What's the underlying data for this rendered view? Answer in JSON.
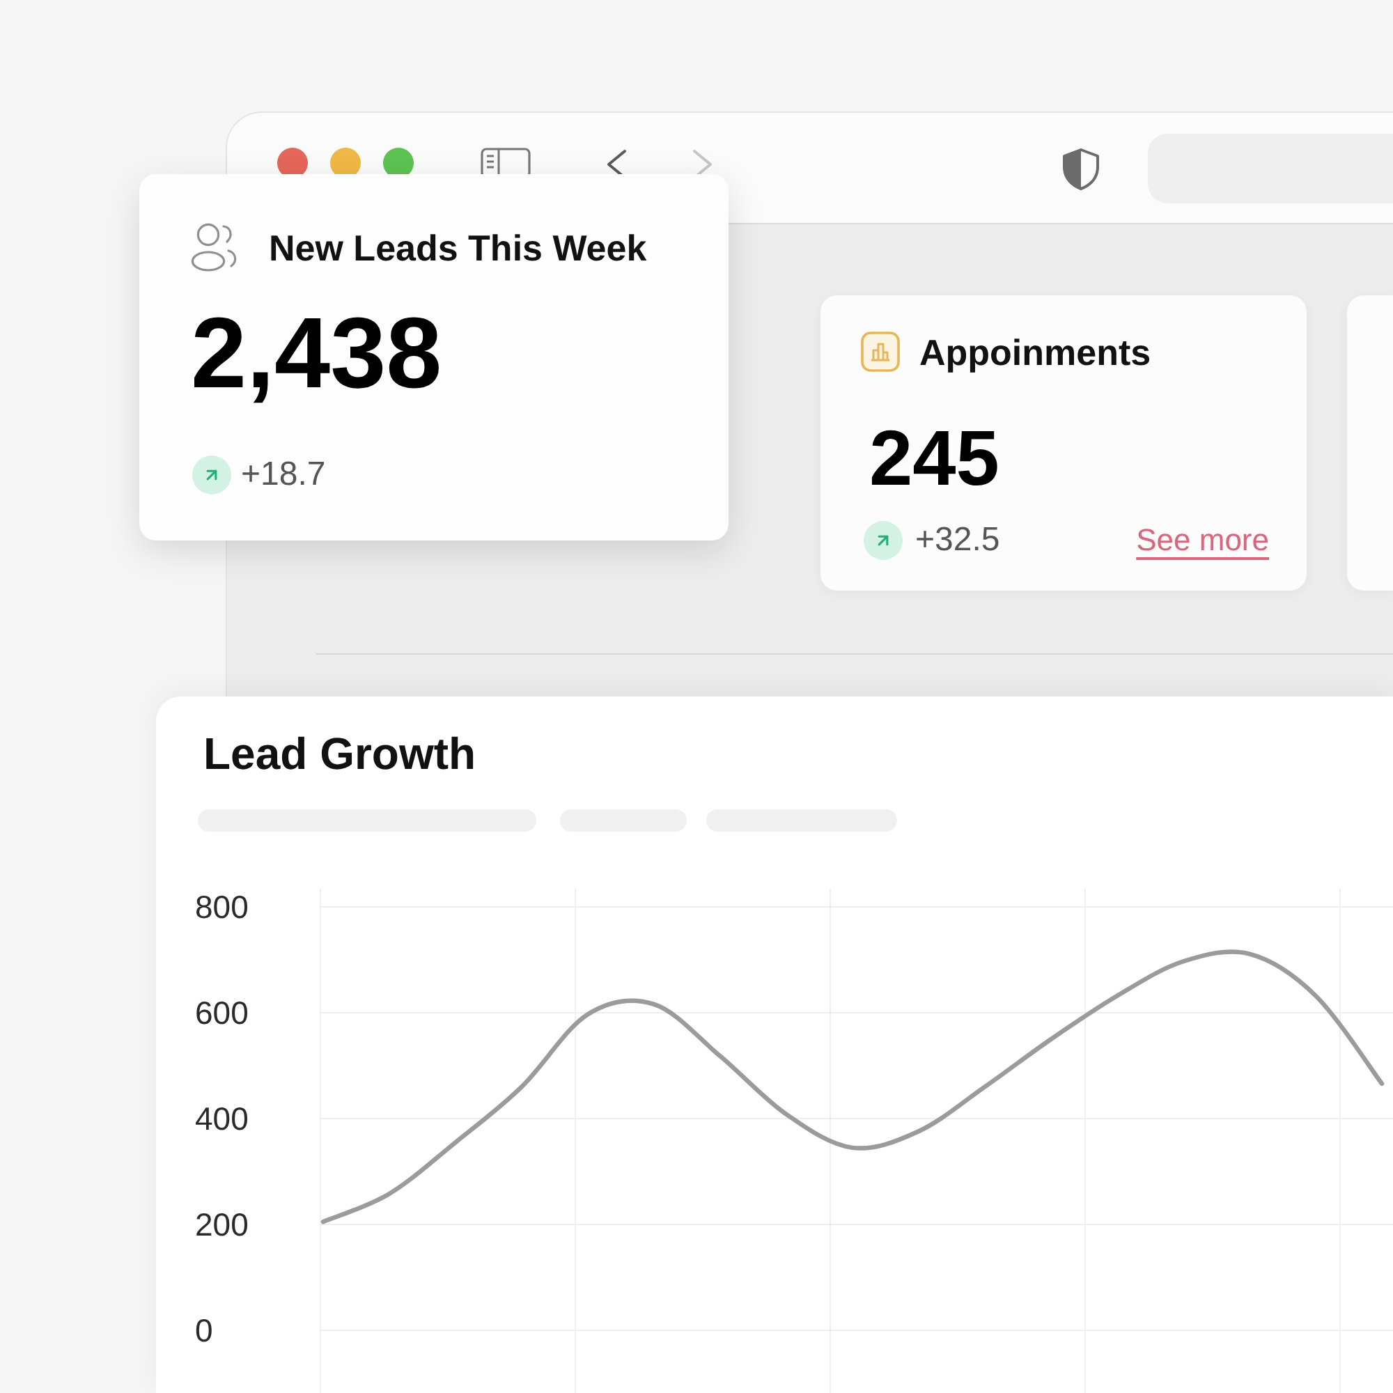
{
  "browser": {
    "back": {
      "disabled": false
    },
    "forward": {
      "disabled": true
    }
  },
  "featured_card": {
    "title": "New Leads This Week",
    "value": "2,438",
    "change": "+18.7"
  },
  "stat_cards": [
    {
      "title": "Appoinments",
      "value": "245",
      "change": "+32.5",
      "link": "See more"
    }
  ],
  "chart_card": {
    "title": "Lead Growth",
    "chart_data": {
      "type": "line",
      "categories": [
        null,
        null,
        null,
        null,
        null,
        null,
        null,
        null,
        null,
        null,
        null,
        null,
        null,
        null,
        null,
        null,
        null
      ],
      "values": [
        205,
        258,
        355,
        460,
        597,
        616,
        518,
        408,
        345,
        376,
        460,
        550,
        632,
        697,
        711,
        632,
        466
      ],
      "ylim": [
        0,
        800
      ],
      "yticks": [
        0,
        200,
        400,
        600,
        800
      ],
      "grid": true
    }
  }
}
